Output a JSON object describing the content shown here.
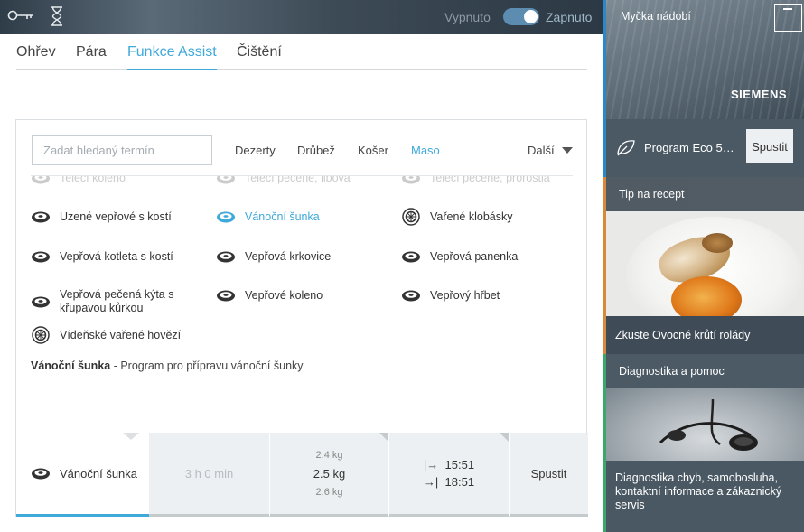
{
  "topbar": {
    "key_icon": "key-icon",
    "timer_icon": "hourglass-icon",
    "power_off_label": "Vypnuto",
    "power_on_label": "Zapnuto",
    "power_state": "on"
  },
  "tabs": [
    {
      "label": "Ohřev"
    },
    {
      "label": "Pára"
    },
    {
      "label": "Funkce Assist",
      "active": true
    },
    {
      "label": "Čištění"
    }
  ],
  "search": {
    "placeholder": "Zadat hledaný termín",
    "value": ""
  },
  "categories": [
    {
      "label": "Dezerty"
    },
    {
      "label": "Drůbež"
    },
    {
      "label": "Košer"
    },
    {
      "label": "Maso",
      "active": true
    }
  ],
  "more_label": "Další",
  "programs": [
    {
      "label": "Telecí koleno",
      "icon": "meat-icon"
    },
    {
      "label": "Telecí pečeně, libová",
      "icon": "meat-icon"
    },
    {
      "label": "Telecí pečeně, prorostlá",
      "icon": "meat-icon"
    },
    {
      "label": "Uzené vepřové s kostí",
      "icon": "meat-icon"
    },
    {
      "label": "Vánoční šunka",
      "icon": "meat-icon",
      "active": true
    },
    {
      "label": "Vařené klobásky",
      "icon": "pot-icon"
    },
    {
      "label": "Vepřová kotleta s kostí",
      "icon": "meat-icon"
    },
    {
      "label": "Vepřová krkovice",
      "icon": "meat-icon"
    },
    {
      "label": "Vepřová panenka",
      "icon": "meat-icon"
    },
    {
      "label": "Vepřová pečená kýta s křupavou kůrkou",
      "icon": "meat-icon"
    },
    {
      "label": "Vepřové koleno",
      "icon": "meat-icon"
    },
    {
      "label": "Vepřový hřbet",
      "icon": "meat-icon"
    },
    {
      "label": "Vídeňské vařené hovězí",
      "icon": "pot-icon"
    }
  ],
  "description": {
    "name": "Vánoční šunka",
    "text": " - Program pro přípravu vánoční šunky"
  },
  "bottom": {
    "program": "Vánoční šunka",
    "duration": "3 h 0 min",
    "weight_prev": "2.4 kg",
    "weight": "2.5 kg",
    "weight_next": "2.6 kg",
    "start_time": "15:51",
    "end_time": "18:51",
    "start_button": "Spustit"
  },
  "sidebar": {
    "appliance_title": "Myčka nádobí",
    "brand": "SIEMENS",
    "eco_program": "Program Eco 5…",
    "eco_button": "Spustit",
    "recipe_header": "Tip na recept",
    "recipe_text": "Zkuste Ovocné krůtí rolády",
    "diag_header": "Diagnostika a pomoc",
    "diag_text": "Diagnostika chyb, samobosluha, kontaktní informace a zákaznický servis"
  },
  "colors": {
    "accent": "#3fa9da",
    "blue_line": "#2a88c8",
    "orange_line": "#d9893a",
    "green_line": "#3aa86b"
  }
}
